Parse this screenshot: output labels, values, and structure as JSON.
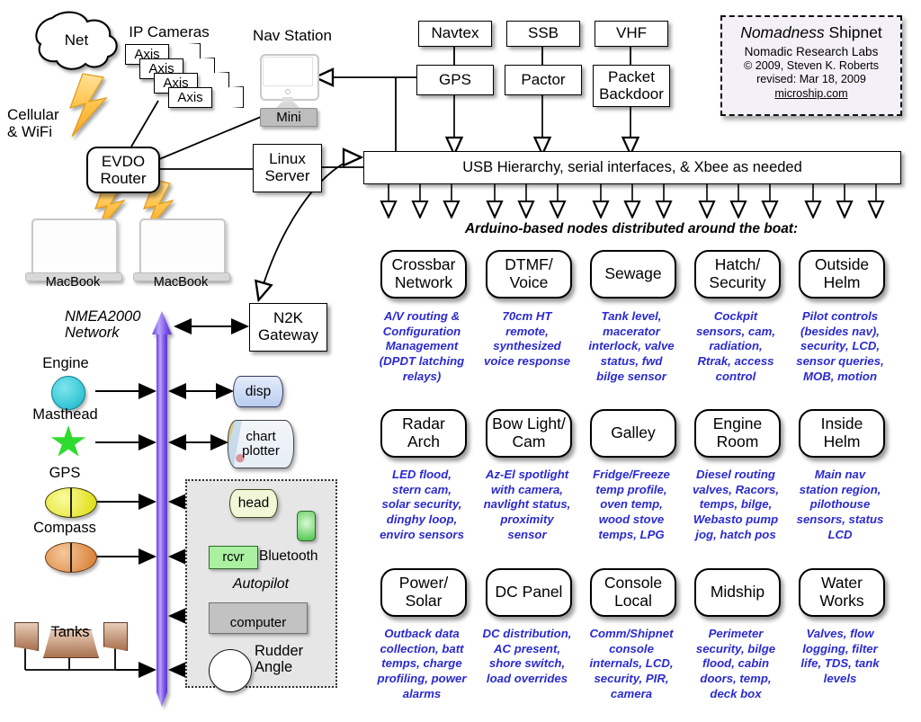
{
  "title_plate": {
    "line1_em": "Nomadness",
    "line1_rest": " Shipnet",
    "line2": "Nomadic Research Labs",
    "line3": "© 2009, Steven K. Roberts",
    "line4": "revised: Mar 18, 2009",
    "line5": "microship.com"
  },
  "internet": {
    "cloud_label": "Net",
    "link_label": "Cellular\n& WiFi"
  },
  "cameras": {
    "group_label": "IP Cameras",
    "items": [
      {
        "label": "Axis"
      },
      {
        "label": "Axis"
      },
      {
        "label": "Axis"
      },
      {
        "label": "Axis"
      }
    ]
  },
  "nav_station": {
    "group_label": "Nav Station",
    "computer_label": "Mini"
  },
  "router": {
    "label": "EVDO\nRouter"
  },
  "laptops": [
    {
      "label": "MacBook"
    },
    {
      "label": "MacBook"
    }
  ],
  "linux_server": {
    "label": "Linux\nServer"
  },
  "radios": {
    "top_row": [
      {
        "label": "Navtex"
      },
      {
        "label": "SSB"
      },
      {
        "label": "VHF"
      }
    ],
    "bottom_row": [
      {
        "label": "GPS"
      },
      {
        "label": "Pactor"
      },
      {
        "label": "Packet\nBackdoor"
      }
    ]
  },
  "usb_bus": {
    "label": "USB Hierarchy, serial interfaces,  & Xbee as needed"
  },
  "nodes_caption": "Arduino-based nodes distributed around the boat:",
  "nodes": [
    {
      "title": "Crossbar\nNetwork",
      "desc": "A/V routing &\nConfiguration\nManagement\n(DPDT latching\nrelays)"
    },
    {
      "title": "DTMF/\nVoice",
      "desc": "70cm HT\nremote,\nsynthesized\nvoice response"
    },
    {
      "title": "Sewage",
      "desc": "Tank level,\nmacerator\ninterlock, valve\nstatus, fwd\nbilge sensor"
    },
    {
      "title": "Hatch/\nSecurity",
      "desc": "Cockpit\nsensors, cam,\nradiation,\nRtrak, access\ncontrol"
    },
    {
      "title": "Outside\nHelm",
      "desc": "Pilot controls\n(besides nav),\nsecurity, LCD,\nsensor queries,\nMOB, motion"
    },
    {
      "title": "Radar\nArch",
      "desc": "LED flood,\nstern cam,\nsolar security,\ndinghy loop,\nenviro sensors"
    },
    {
      "title": "Bow Light/\nCam",
      "desc": "Az-El spotlight\nwith camera,\nnavlight status,\nproximity\nsensor"
    },
    {
      "title": "Galley",
      "desc": "Fridge/Freeze\ntemp profile,\noven temp,\nwood stove\ntemps, LPG"
    },
    {
      "title": "Engine\nRoom",
      "desc": "Diesel routing\nvalves, Racors,\ntemps, bilge,\nWebasto pump\njog, hatch pos"
    },
    {
      "title": "Inside\nHelm",
      "desc": "Main nav\nstation region,\npilothouse\nsensors, status\nLCD"
    },
    {
      "title": "Power/\nSolar",
      "desc": "Outback data\ncollection, batt\ntemps, charge\nprofiling, power\nalarms"
    },
    {
      "title": "DC Panel",
      "desc": "DC distribution,\nAC present,\nshore switch,\nload overrides"
    },
    {
      "title": "Console\nLocal",
      "desc": "Comm/Shipnet\nconsole\ninternals, LCD,\nsecurity, PIR,\ncamera"
    },
    {
      "title": "Midship",
      "desc": "Perimeter\nsecurity, bilge\nflood, cabin\ndoors, temp,\ndeck box"
    },
    {
      "title": "Water\nWorks",
      "desc": "Valves, flow\nlogging, filter\nlife, TDS, tank\nlevels"
    }
  ],
  "n2k": {
    "bus_label": "NMEA2000\nNetwork",
    "gateway_label": "N2K\nGateway",
    "sensors": [
      {
        "label": "Engine"
      },
      {
        "label": "Masthead"
      },
      {
        "label": "GPS"
      },
      {
        "label": "Compass"
      },
      {
        "label": "Tanks"
      }
    ],
    "displays": [
      {
        "label": "disp"
      },
      {
        "label": "chart\nplotter"
      }
    ],
    "autopilot": {
      "group_label": "Autopilot",
      "head_label": "head",
      "rcvr_label": "rcvr",
      "bluetooth_label": "Bluetooth",
      "computer_label": "computer",
      "rudder_label": "Rudder\nAngle"
    }
  },
  "colors": {
    "bus_purple": "#8a62ee",
    "desc_blue": "#2a2ad0",
    "bolt_orange": "#ffc34d",
    "engine_cyan": "#13b6c9",
    "masthead_green": "#2fdb2f",
    "gps_yellow": "#e8e800",
    "compass_orange": "#e08030",
    "plate_bg": "#f4f0f7"
  }
}
